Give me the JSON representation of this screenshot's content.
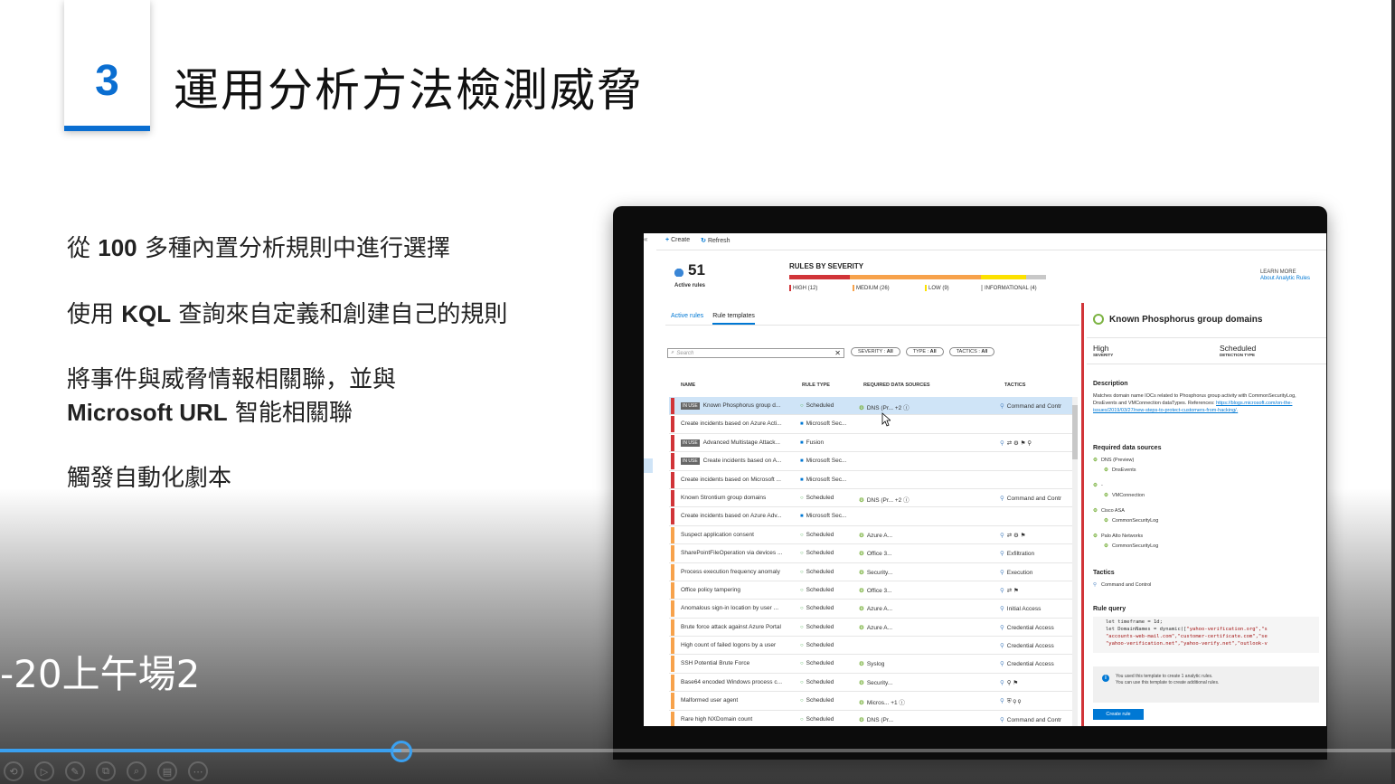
{
  "slide": {
    "number": "3",
    "title": "運用分析方法檢測威脅",
    "bullets": {
      "b1_pre": "從 ",
      "b1_bold": "100",
      "b1_post": " 多種內置分析規則中進行選擇",
      "b2_pre": "使用 ",
      "b2_bold": "KQL",
      "b2_post": " 查詢來自定義和創建自己的規則",
      "b3_line1": "將事件與威脅情報相關聯，並與",
      "b3_bold": "Microsoft URL",
      "b3_post": " 智能相關聯",
      "b4": "觸發自動化劇本"
    },
    "caption": "-20上午場2"
  },
  "player": {
    "progress": 0.288,
    "controls": [
      "⟲",
      "▷",
      "✎",
      "⧉",
      "⌕",
      "▤",
      "⋯"
    ]
  },
  "screen": {
    "collapse": "«",
    "toolbar": {
      "create": "Create",
      "refresh": "Refresh"
    },
    "active_rules": {
      "count": "51",
      "label": "Active rules"
    },
    "severity": {
      "title": "RULES BY SEVERITY",
      "legend": [
        {
          "label": "HIGH (12)",
          "color": "#d13438",
          "value": 12
        },
        {
          "label": "MEDIUM (26)",
          "color": "#f7a24b",
          "value": 26
        },
        {
          "label": "LOW (9)",
          "color": "#fce100",
          "value": 9
        },
        {
          "label": "INFORMATIONAL (4)",
          "color": "#c8c8c8",
          "value": 4
        }
      ]
    },
    "learn_more": {
      "label": "LEARN MORE",
      "link": "About Analytic Rules"
    },
    "tabs": [
      "Active rules",
      "Rule templates"
    ],
    "search_placeholder": "Search",
    "search_clear": "✕",
    "filters": [
      {
        "key": "SEVERITY : ",
        "val": "All"
      },
      {
        "key": "TYPE : ",
        "val": "All"
      },
      {
        "key": "TACTICS : ",
        "val": "All"
      }
    ],
    "columns": [
      "NAME",
      "RULE TYPE",
      "REQUIRED DATA SOURCES",
      "TACTICS"
    ],
    "rows": [
      {
        "sev": "#d13438",
        "inuse": "IN USE",
        "name": "Known Phosphorus group d...",
        "type": "Scheduled",
        "tdot": "green",
        "src": "DNS (Pr... +2 ⓘ",
        "tactics": "Command and Contr",
        "sel": true
      },
      {
        "sev": "#d13438",
        "inuse": "",
        "name": "Create incidents based on Azure Acti...",
        "type": "Microsoft Sec...",
        "tdot": "blue",
        "src": "",
        "tactics": ""
      },
      {
        "sev": "#d13438",
        "inuse": "IN USE",
        "name": "Advanced Multistage Attack...",
        "type": "Fusion",
        "tdot": "blue",
        "src": "",
        "tactics": "⇄ ⚙ ⚑ ⚲"
      },
      {
        "sev": "#d13438",
        "inuse": "IN USE",
        "name": "Create incidents based on A...",
        "type": "Microsoft Sec...",
        "tdot": "blue",
        "src": "",
        "tactics": ""
      },
      {
        "sev": "#d13438",
        "inuse": "",
        "name": "Create incidents based on Microsoft ...",
        "type": "Microsoft Sec...",
        "tdot": "blue",
        "src": "",
        "tactics": ""
      },
      {
        "sev": "#d13438",
        "inuse": "",
        "name": "Known Strontium group domains",
        "type": "Scheduled",
        "tdot": "green",
        "src": "DNS (Pr... +2 ⓘ",
        "tactics": "Command and Contr"
      },
      {
        "sev": "#d13438",
        "inuse": "",
        "name": "Create incidents based on Azure Adv...",
        "type": "Microsoft Sec...",
        "tdot": "blue",
        "src": "",
        "tactics": ""
      },
      {
        "sev": "#f7a24b",
        "inuse": "",
        "name": "Suspect application consent",
        "type": "Scheduled",
        "tdot": "green",
        "src": "Azure A...",
        "tactics": "⇄ ⚙ ⚑"
      },
      {
        "sev": "#f7a24b",
        "inuse": "",
        "name": "SharePointFileOperation via devices ...",
        "type": "Scheduled",
        "tdot": "green",
        "src": "Office 3...",
        "tactics": "Exfiltration"
      },
      {
        "sev": "#f7a24b",
        "inuse": "",
        "name": "Process execution frequency anomaly",
        "type": "Scheduled",
        "tdot": "green",
        "src": "Security...",
        "tactics": "Execution"
      },
      {
        "sev": "#f7a24b",
        "inuse": "",
        "name": "Office policy tampering",
        "type": "Scheduled",
        "tdot": "green",
        "src": "Office 3...",
        "tactics": "⇄ ⚑"
      },
      {
        "sev": "#f7a24b",
        "inuse": "",
        "name": "Anomalous sign-in location by user ...",
        "type": "Scheduled",
        "tdot": "green",
        "src": "Azure A...",
        "tactics": "Initial Access"
      },
      {
        "sev": "#f7a24b",
        "inuse": "",
        "name": "Brute force attack against Azure Portal",
        "type": "Scheduled",
        "tdot": "green",
        "src": "Azure A...",
        "tactics": "Credential Access"
      },
      {
        "sev": "#f7a24b",
        "inuse": "",
        "name": "High count of failed logons by a user",
        "type": "Scheduled",
        "tdot": "green",
        "src": "",
        "tactics": "Credential Access"
      },
      {
        "sev": "#f7a24b",
        "inuse": "",
        "name": "SSH Potential Brute Force",
        "type": "Scheduled",
        "tdot": "green",
        "src": "Syslog",
        "tactics": "Credential Access"
      },
      {
        "sev": "#f7a24b",
        "inuse": "",
        "name": "Base64 encoded Windows process c...",
        "type": "Scheduled",
        "tdot": "green",
        "src": "Security...",
        "tactics": "⚲ ⚑"
      },
      {
        "sev": "#f7a24b",
        "inuse": "",
        "name": "Malformed user agent",
        "type": "Scheduled",
        "tdot": "green",
        "src": "Micros... +1 ⓘ",
        "tactics": "⛨ ⚲ ⚲"
      },
      {
        "sev": "#f7a24b",
        "inuse": "",
        "name": "Rare high NXDomain count",
        "type": "Scheduled",
        "tdot": "green",
        "src": "DNS (Pr...",
        "tactics": "Command and Contr"
      }
    ],
    "detail": {
      "title": "Known Phosphorus group domains",
      "severity_val": "High",
      "severity_key": "SEVERITY",
      "type_val": "Scheduled",
      "type_key": "DETECTION TYPE",
      "description_h": "Description",
      "description": "Matches domain name IOCs related to Phosphorus group activity with CommonSecurityLog, DnsEvents and VMConnection dataTypes. References: ",
      "description_link": "https://blogs.microsoft.com/on-the-issues/2019/03/27/new-steps-to-protect-customers-from-hacking/.",
      "sources_h": "Required data sources",
      "sources": [
        {
          "name": "DNS (Preview)",
          "sub": "DnsEvents"
        },
        {
          "name": "-",
          "sub": "VMConnection"
        },
        {
          "name": "Cisco ASA",
          "sub": "CommonSecurityLog"
        },
        {
          "name": "Palo Alto Networks",
          "sub": "CommonSecurityLog"
        }
      ],
      "tactics_h": "Tactics",
      "tactics": "Command and Control",
      "query_h": "Rule query",
      "query_l1": "let timeframe = 1d;",
      "query_l2a": "let DomainNames = dynamic([",
      "query_l2b": "\"yahoo-verification.org\",\"s",
      "query_l3": "\"accounts-web-mail.com\",\"customer-certificate.com\",\"se",
      "query_l4": "\"yahoo-verification.net\",\"yahoo-verify.net\",\"outlook-v",
      "info_l1": "You used this template to create 1 analytic rules.",
      "info_l2": "You can use this template to create additional rules.",
      "create_rule": "Create rule"
    }
  }
}
